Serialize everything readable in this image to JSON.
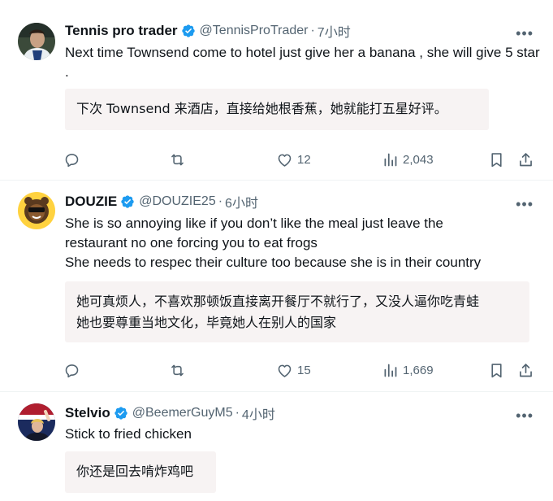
{
  "colors": {
    "verified": "#1d9bf0",
    "muted": "#536471",
    "text": "#0f1419",
    "translation_bg": "#f7f3f3"
  },
  "tweets": [
    {
      "name": "Tennis pro trader",
      "handle": "@TennisProTrader",
      "time": "7小时",
      "text": "Next time Townsend come to hotel just give her a banana , she will give 5 star .",
      "translation": "下次 Townsend 来酒店，直接给她根香蕉，她就能打五星好评。",
      "likes": "12",
      "views": "2,043"
    },
    {
      "name": "DOUZIE",
      "handle": "@DOUZIE25",
      "time": "6小时",
      "text_lines": [
        "She is so annoying like if you don’t like the meal just leave the",
        "restaurant no one forcing you to eat frogs",
        "She needs to respec their culture too because she is in their country"
      ],
      "translation_lines": [
        "她可真烦人，不喜欢那顿饭直接离开餐厅不就行了，又没人逼你吃青蛙",
        "她也要尊重当地文化，毕竟她人在别人的国家"
      ],
      "likes": "15",
      "views": "1,669"
    },
    {
      "name": "Stelvio",
      "handle": "@BeemerGuyM5",
      "time": "4小时",
      "text": "Stick to fried chicken",
      "translation": "你还是回去啃炸鸡吧"
    }
  ],
  "separator": "·",
  "more_glyph": "•••",
  "icons": [
    "reply-icon",
    "retweet-icon",
    "like-icon",
    "views-icon",
    "bookmark-icon",
    "share-icon",
    "verified-badge-icon",
    "more-icon"
  ]
}
